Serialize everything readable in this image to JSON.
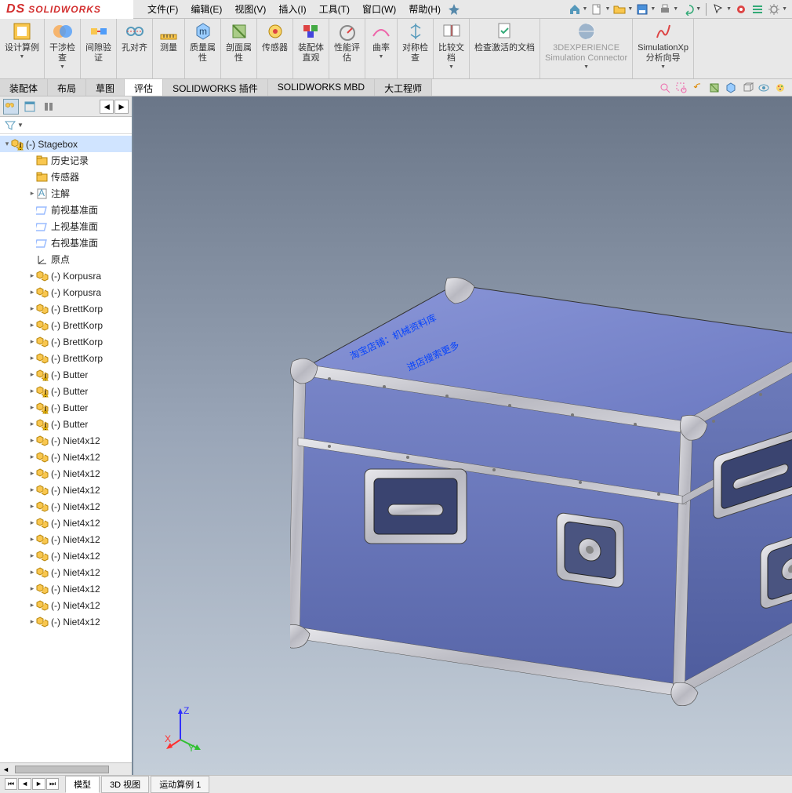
{
  "app": {
    "name": "SOLIDWORKS"
  },
  "menus": [
    "文件(F)",
    "编辑(E)",
    "视图(V)",
    "插入(I)",
    "工具(T)",
    "窗口(W)",
    "帮助(H)"
  ],
  "ribbon": [
    {
      "id": "design-example",
      "label": "设计算例",
      "drop": true
    },
    {
      "id": "interference-check",
      "label": "干涉检\n查",
      "drop": true
    },
    {
      "id": "clearance-verify",
      "label": "间隙验\n证"
    },
    {
      "id": "hole-align",
      "label": "孔对齐"
    },
    {
      "id": "measure",
      "label": "测量"
    },
    {
      "id": "mass-props",
      "label": "质量属\n性"
    },
    {
      "id": "section-props",
      "label": "剖面属\n性"
    },
    {
      "id": "sensor",
      "label": "传感器"
    },
    {
      "id": "assy-visual",
      "label": "装配体\n直观"
    },
    {
      "id": "perf-eval",
      "label": "性能评\n估"
    },
    {
      "id": "curvature",
      "label": "曲率",
      "drop": true
    },
    {
      "id": "sym-check",
      "label": "对称检\n查"
    },
    {
      "id": "compare-docs",
      "label": "比较文\n档",
      "drop": true
    },
    {
      "id": "check-active",
      "label": "检查激活的文档"
    },
    {
      "id": "3dexp",
      "label": "3DEXPERIENCE\nSimulation Connector",
      "disabled": true,
      "drop": true
    },
    {
      "id": "simxpress",
      "label": "SimulationXp\n分析向导",
      "drop": true
    }
  ],
  "cmdtabs": [
    "装配体",
    "布局",
    "草图",
    "评估",
    "SOLIDWORKS 插件",
    "SOLIDWORKS MBD",
    "大工程师"
  ],
  "cmdtab_selected": "评估",
  "tree_root": "(-) Stagebox",
  "tree": [
    {
      "icon": "folder",
      "label": "历史记录",
      "ind": 2
    },
    {
      "icon": "folder",
      "label": "传感器",
      "ind": 2
    },
    {
      "icon": "anno",
      "label": "注解",
      "ind": 2,
      "caret": true
    },
    {
      "icon": "plane",
      "label": "前视基准面",
      "ind": 2
    },
    {
      "icon": "plane",
      "label": "上视基准面",
      "ind": 2
    },
    {
      "icon": "plane",
      "label": "右视基准面",
      "ind": 2
    },
    {
      "icon": "origin",
      "label": "原点",
      "ind": 2
    },
    {
      "icon": "asm",
      "label": "(-) Korpusra",
      "ind": 2,
      "caret": true
    },
    {
      "icon": "asm",
      "label": "(-) Korpusra",
      "ind": 2,
      "caret": true
    },
    {
      "icon": "asm",
      "label": "(-) BrettKorp",
      "ind": 2,
      "caret": true
    },
    {
      "icon": "asm",
      "label": "(-) BrettKorp",
      "ind": 2,
      "caret": true
    },
    {
      "icon": "asm",
      "label": "(-) BrettKorp",
      "ind": 2,
      "caret": true
    },
    {
      "icon": "asm",
      "label": "(-) BrettKorp",
      "ind": 2,
      "caret": true
    },
    {
      "icon": "asmw",
      "label": "(-) Butter",
      "ind": 2,
      "caret": true
    },
    {
      "icon": "asmw",
      "label": "(-) Butter",
      "ind": 2,
      "caret": true
    },
    {
      "icon": "asmw",
      "label": "(-) Butter",
      "ind": 2,
      "caret": true
    },
    {
      "icon": "asmw",
      "label": "(-) Butter",
      "ind": 2,
      "caret": true
    },
    {
      "icon": "asm",
      "label": "(-) Niet4x12",
      "ind": 2,
      "caret": true
    },
    {
      "icon": "asm",
      "label": "(-) Niet4x12",
      "ind": 2,
      "caret": true
    },
    {
      "icon": "asm",
      "label": "(-) Niet4x12",
      "ind": 2,
      "caret": true
    },
    {
      "icon": "asm",
      "label": "(-) Niet4x12",
      "ind": 2,
      "caret": true
    },
    {
      "icon": "asm",
      "label": "(-) Niet4x12",
      "ind": 2,
      "caret": true
    },
    {
      "icon": "asm",
      "label": "(-) Niet4x12",
      "ind": 2,
      "caret": true
    },
    {
      "icon": "asm",
      "label": "(-) Niet4x12",
      "ind": 2,
      "caret": true
    },
    {
      "icon": "asm",
      "label": "(-) Niet4x12",
      "ind": 2,
      "caret": true
    },
    {
      "icon": "asm",
      "label": "(-) Niet4x12",
      "ind": 2,
      "caret": true
    },
    {
      "icon": "asm",
      "label": "(-) Niet4x12",
      "ind": 2,
      "caret": true
    },
    {
      "icon": "asm",
      "label": "(-) Niet4x12",
      "ind": 2,
      "caret": true
    },
    {
      "icon": "asm",
      "label": "(-) Niet4x12",
      "ind": 2,
      "caret": true
    }
  ],
  "watermark": {
    "line1": "淘宝店铺：机械资料库",
    "line2": "进店搜索更多"
  },
  "bottom_tabs": [
    "模型",
    "3D 视图",
    "运动算例 1"
  ],
  "bottom_selected": "模型",
  "triad_labels": {
    "x": "X",
    "y": "Y",
    "z": "Z"
  }
}
